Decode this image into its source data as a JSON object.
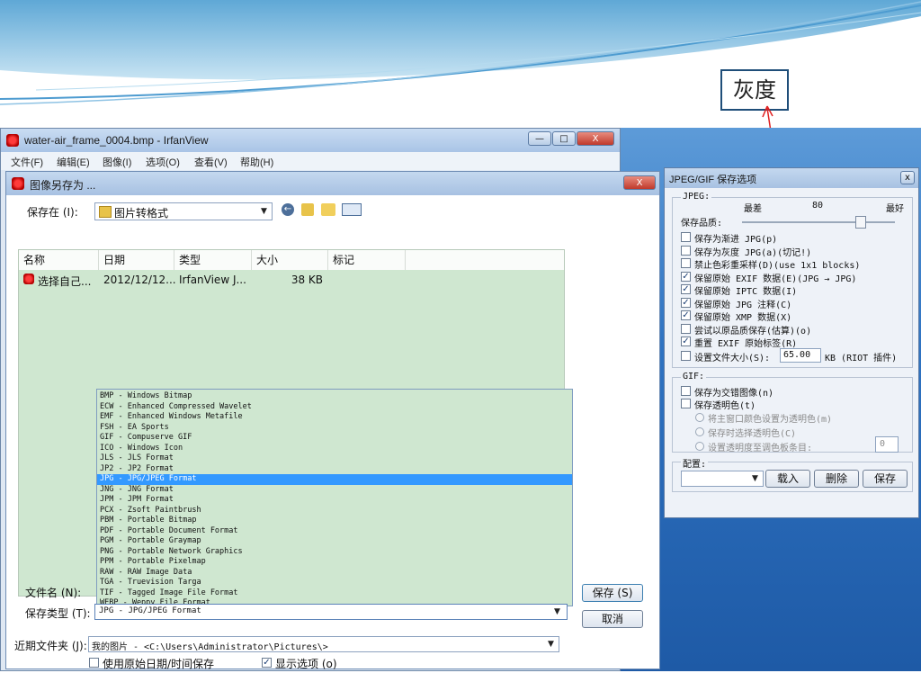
{
  "callout": {
    "label": "灰度"
  },
  "main_window": {
    "title": "water-air_frame_0004.bmp - IrfanView",
    "min_label": "—",
    "max_label": "□",
    "close_label": "X",
    "menu": [
      "文件(F)",
      "编辑(E)",
      "图像(I)",
      "选项(O)",
      "查看(V)",
      "帮助(H)"
    ]
  },
  "save_dialog": {
    "title": "图像另存为 ...",
    "close_label": "X",
    "save_in_label": "保存在 (I):",
    "save_in_value": "图片转格式",
    "columns": [
      "名称",
      "日期",
      "类型",
      "大小",
      "标记"
    ],
    "file_row": {
      "name": "选择自己...",
      "date": "2012/12/12...",
      "type": "IrfanView J...",
      "size": "38 KB",
      "tag": ""
    },
    "file_types": [
      "BMP - Windows Bitmap",
      "ECW - Enhanced Compressed Wavelet",
      "EMF - Enhanced Windows Metafile",
      "FSH - EA Sports",
      "GIF - Compuserve GIF",
      "ICO - Windows Icon",
      "JLS - JLS Format",
      "JP2 - JP2 Format",
      "JPG - JPG/JPEG Format",
      "JNG - JNG Format",
      "JPM - JPM Format",
      "PCX - Zsoft Paintbrush",
      "PBM - Portable Bitmap",
      "PDF - Portable Document Format",
      "PGM - Portable Graymap",
      "PNG - Portable Network Graphics",
      "PPM - Portable Pixelmap",
      "RAW - RAW Image Data",
      "TGA - Truevision Targa",
      "TIF - Tagged Image File Format",
      "WEBP - Weppy File Format"
    ],
    "selected_type_index": 8,
    "filename_label": "文件名 (N):",
    "filetype_label": "保存类型 (T):",
    "filetype_value": "JPG - JPG/JPEG Format",
    "save_button": "保存 (S)",
    "cancel_button": "取消",
    "recent_label": "近期文件夹 (J):",
    "recent_value": "我的图片  -  <C:\\Users\\Administrator\\Pictures\\>",
    "keep_date_label": "使用原始日期/时间保存",
    "show_options_label": "显示选项 (o)",
    "keep_date_checked": false,
    "show_options_checked": true
  },
  "jpeg_dialog": {
    "title": "JPEG/GIF 保存选项",
    "close_label": "x",
    "jpeg_group": "JPEG:",
    "quality_min": "最差",
    "quality_value": "80",
    "quality_max": "最好",
    "quality_label": "保存品质:",
    "quality_fraction": 0.8,
    "options": [
      {
        "label": "保存为渐进 JPG(p)",
        "checked": false
      },
      {
        "label": "保存为灰度 JPG(a)(切记!)",
        "checked": false
      },
      {
        "label": "禁止色彩重采样(D)(use 1x1 blocks)",
        "checked": false
      },
      {
        "label": "保留原始 EXIF 数据(E)(JPG → JPG)",
        "checked": true
      },
      {
        "label": "保留原始 IPTC 数据(I)",
        "checked": true
      },
      {
        "label": "保留原始 JPG 注释(C)",
        "checked": true
      },
      {
        "label": "保留原始 XMP 数据(X)",
        "checked": true
      },
      {
        "label": "尝试以原品质保存(估算)(o)",
        "checked": false
      },
      {
        "label": "重置 EXIF 原始标签(R)",
        "checked": true
      }
    ],
    "filesize_label": "设置文件大小(S):",
    "filesize_value": "65.00",
    "filesize_unit": "KB (RIOT 插件)",
    "gif_group": "GIF:",
    "gif_interlaced": "保存为交错图像(n)",
    "gif_transparent": "保存透明色(t)",
    "radio1": "将主窗口颜色设置为透明色(m)",
    "radio2": "保存时选择透明色(C)",
    "radio3": "设置透明度至调色板条目:",
    "palette_value": "0",
    "config_label": "配置:",
    "load_button": "载入",
    "delete_button": "删除",
    "save_button": "保存"
  }
}
